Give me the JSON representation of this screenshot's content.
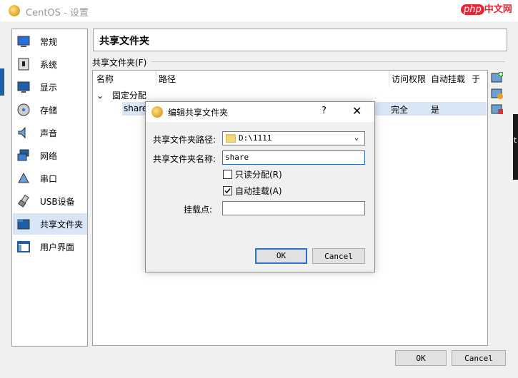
{
  "window": {
    "title": "CentOS - 设置",
    "watermark_php": "php",
    "watermark_cn": "中文网"
  },
  "sidebar": {
    "items": [
      {
        "label": "常规",
        "icon": "general-icon"
      },
      {
        "label": "系统",
        "icon": "system-icon"
      },
      {
        "label": "显示",
        "icon": "display-icon"
      },
      {
        "label": "存储",
        "icon": "storage-icon"
      },
      {
        "label": "声音",
        "icon": "audio-icon"
      },
      {
        "label": "网络",
        "icon": "network-icon"
      },
      {
        "label": "串口",
        "icon": "serial-port-icon"
      },
      {
        "label": "USB设备",
        "icon": "usb-icon"
      },
      {
        "label": "共享文件夹",
        "icon": "shared-folder-icon"
      },
      {
        "label": "用户界面",
        "icon": "user-interface-icon"
      }
    ],
    "selected": "共享文件夹"
  },
  "page": {
    "title": "共享文件夹",
    "section_label": "共享文件夹(F)",
    "columns": [
      "名称",
      "路径",
      "访问权限",
      "自动挂载",
      "于"
    ],
    "group": "固定分配",
    "row": {
      "name": "share",
      "access": "完全",
      "auto_mount": "是"
    }
  },
  "buttons": {
    "ok": "OK",
    "cancel": "Cancel"
  },
  "dialog": {
    "title": "编辑共享文件夹",
    "help": "?",
    "close": "✕",
    "path_label": "共享文件夹路径:",
    "path_value": "D:\\1111",
    "name_label": "共享文件夹名称:",
    "name_value": "share",
    "readonly_label": "只读分配(R)",
    "readonly_checked": false,
    "automount_label": "自动挂载(A)",
    "automount_checked": true,
    "mountpoint_label": "挂载点:",
    "mountpoint_value": "",
    "ok": "OK",
    "cancel": "Cancel"
  },
  "right_edge_text": "t"
}
